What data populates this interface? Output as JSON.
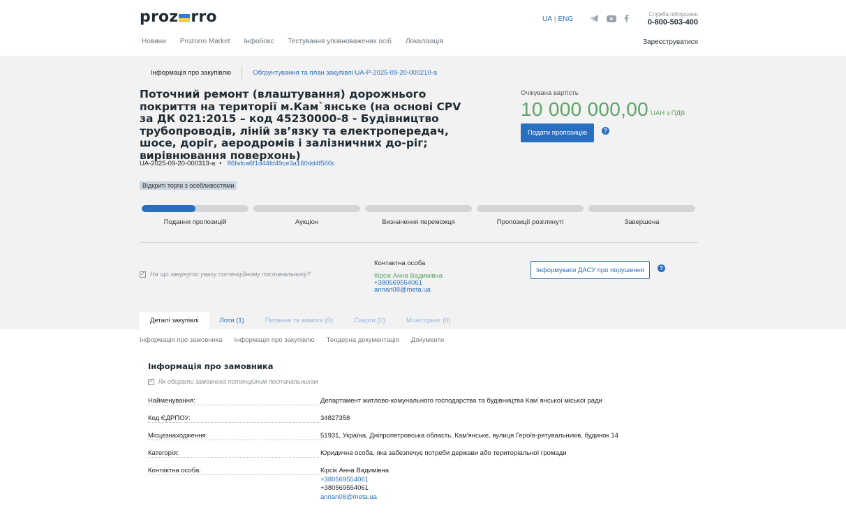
{
  "header": {
    "logo": {
      "left": "prozorro"
    },
    "lang": {
      "ua": "UA",
      "sep": "|",
      "eng": "ENG"
    },
    "social_icons": [
      "telegram-icon",
      "youtube-icon",
      "facebook-icon"
    ],
    "support": {
      "label": "Служба підтримки",
      "phone": "0-800-503-400"
    },
    "nav": [
      "Новини",
      "Prozorro Market",
      "Інфобокс",
      "Тестування уповноважених осіб",
      "Локалізація"
    ],
    "register": "Зареєструватися"
  },
  "subnav": {
    "current": "Інформація про закупівлю",
    "plan_link": "Обгрунтування та план закупівлі UA-P-2025-09-20-000210-a"
  },
  "tender": {
    "title": "Поточний ремонт (влаштування) дорожнього покриття на території м.Кам`янське (на основі CPV за ДК 021:2015 – код 45230000-8 - Будівництво трубопроводів, ліній зв’язку та електропередач, шосе, доріг, аеродромів і залізничних до-ріг; вирівнювання поверхонь)",
    "id": "UA-2025-09-20-000313-a",
    "dot": "•",
    "hash": "86fafca6f1d44fd49ce3a160dd4f560c",
    "badge": "Відкриті торги з особливостями"
  },
  "estimate": {
    "label": "Очікувана вартість",
    "value": "10 000 000,00",
    "unit": "UAH з ПДВ",
    "submit_button": "Подати пропозицію",
    "help": "?"
  },
  "stages": {
    "labels": [
      "Подання пропозицій",
      "Аукціон",
      "Визначення переможця",
      "Пропозиції розглянуті",
      "Завершена"
    ],
    "active_index": 0,
    "active_progress": 0.5
  },
  "hint": {
    "text": "На що звернути увагу потенційному постачальнику?"
  },
  "contact": {
    "label": "Контактна особа",
    "name": "Кірсік Анна Вадимівна",
    "phone": "+380569554061",
    "email": "annan08@meta.ua"
  },
  "report_button": "Інформувати ДАСУ про порушення",
  "tabs": [
    {
      "label": "Деталі закупівлі"
    },
    {
      "label": "Лоти (1)"
    },
    {
      "label": "Питання та вимоги (0)"
    },
    {
      "label": "Скарги (0)"
    },
    {
      "label": "Моніторинг (0)"
    }
  ],
  "subtabs": [
    "Інформація про замовника",
    "Інформація про закупівлю",
    "Тендерна документація",
    "Документи"
  ],
  "customer": {
    "title": "Інформація про замовника",
    "hint": "Як обирати замовника потенційним постачальникам",
    "rows": [
      {
        "key": "Найменування:",
        "value": "Департамент житлово-комунального господарства та будівництва Кам`янської міської ради"
      },
      {
        "key": "Код ЄДРПОУ:",
        "value": "34827358"
      },
      {
        "key": "Місцезнаходження:",
        "value": "51931, Україна, Дніпропетровська область, Кам'янське, вулиця Героїв-рятувальників, будинок 14"
      },
      {
        "key": "Категорія:",
        "value": "Юридична особа, яка забезпечує потреби держави або територіальної громади"
      }
    ],
    "contact_row": {
      "key": "Контактна особа:",
      "name": "Кірсік Анна Вадимівна",
      "phone_link": "+380569554061",
      "phone": "+380569554061",
      "email": "annan08@meta.ua"
    }
  },
  "colors": {
    "accent": "#2a6fbf",
    "green": "#5ea36a",
    "gray_bg": "#f2f2f2",
    "progress_track": "#d3d6d9"
  }
}
